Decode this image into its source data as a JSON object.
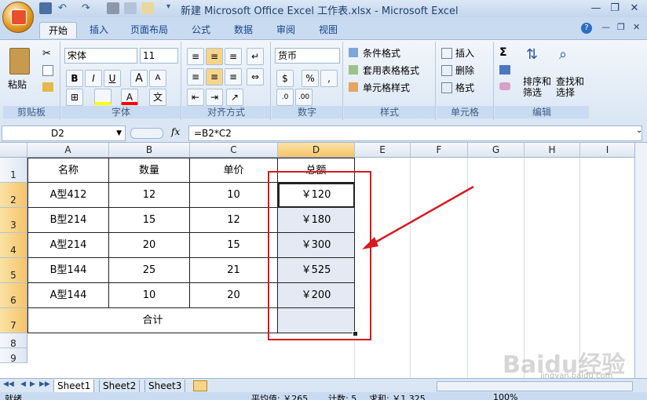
{
  "window": {
    "title": "新建 Microsoft Office Excel 工作表.xlsx - Microsoft Excel",
    "minimize": "—",
    "restore": "❐",
    "close": "✕"
  },
  "tabs": [
    "开始",
    "插入",
    "页面布局",
    "公式",
    "数据",
    "审阅",
    "视图"
  ],
  "ribbon": {
    "clipboard": {
      "label": "剪贴板",
      "paste": "粘贴"
    },
    "font": {
      "label": "字体",
      "name": "宋体",
      "size": "11",
      "bold": "B",
      "italic": "I",
      "underline": "U",
      "grow": "A",
      "shrink": "A",
      "fill_color": "#ffff00",
      "font_color": "#ff0000"
    },
    "alignment": {
      "label": "对齐方式"
    },
    "number": {
      "label": "数字",
      "format": "货币",
      "percent": "%",
      "comma": ","
    },
    "styles": {
      "label": "样式",
      "conditional": "条件格式",
      "table": "套用表格格式",
      "cell_styles": "单元格样式"
    },
    "cells": {
      "label": "单元格",
      "insert": "插入",
      "delete": "删除",
      "format": "格式"
    },
    "editing": {
      "label": "编辑",
      "sum": "Σ",
      "sort": "排序和\n筛选",
      "find": "查找和\n选择"
    }
  },
  "formula_bar": {
    "name_box": "D2",
    "fx": "fx",
    "formula": "=B2*C2"
  },
  "columns": [
    "A",
    "B",
    "C",
    "D",
    "E",
    "F",
    "G",
    "H",
    "I"
  ],
  "rows": [
    "1",
    "2",
    "3",
    "4",
    "5",
    "6",
    "7",
    "8",
    "9"
  ],
  "table": {
    "header": [
      "名称",
      "数量",
      "单价",
      "总额"
    ],
    "rows": [
      [
        "A型412",
        "12",
        "10",
        "￥120"
      ],
      [
        "B型214",
        "15",
        "12",
        "￥180"
      ],
      [
        "A型214",
        "20",
        "15",
        "￥300"
      ],
      [
        "B型144",
        "25",
        "21",
        "￥525"
      ],
      [
        "A型144",
        "10",
        "20",
        "￥200"
      ]
    ],
    "total_label": "合计"
  },
  "sheets": [
    "Sheet1",
    "Sheet2",
    "Sheet3"
  ],
  "status": {
    "ready": "就绪",
    "average": "平均值: ￥265",
    "count": "计数: 5",
    "sum": "求和: ￥1,325",
    "zoom": "100%"
  },
  "watermark": "Baidu经验",
  "watermark_sub": "jingyan.baidu.com",
  "colors": {
    "annotation": "#d7191f"
  }
}
